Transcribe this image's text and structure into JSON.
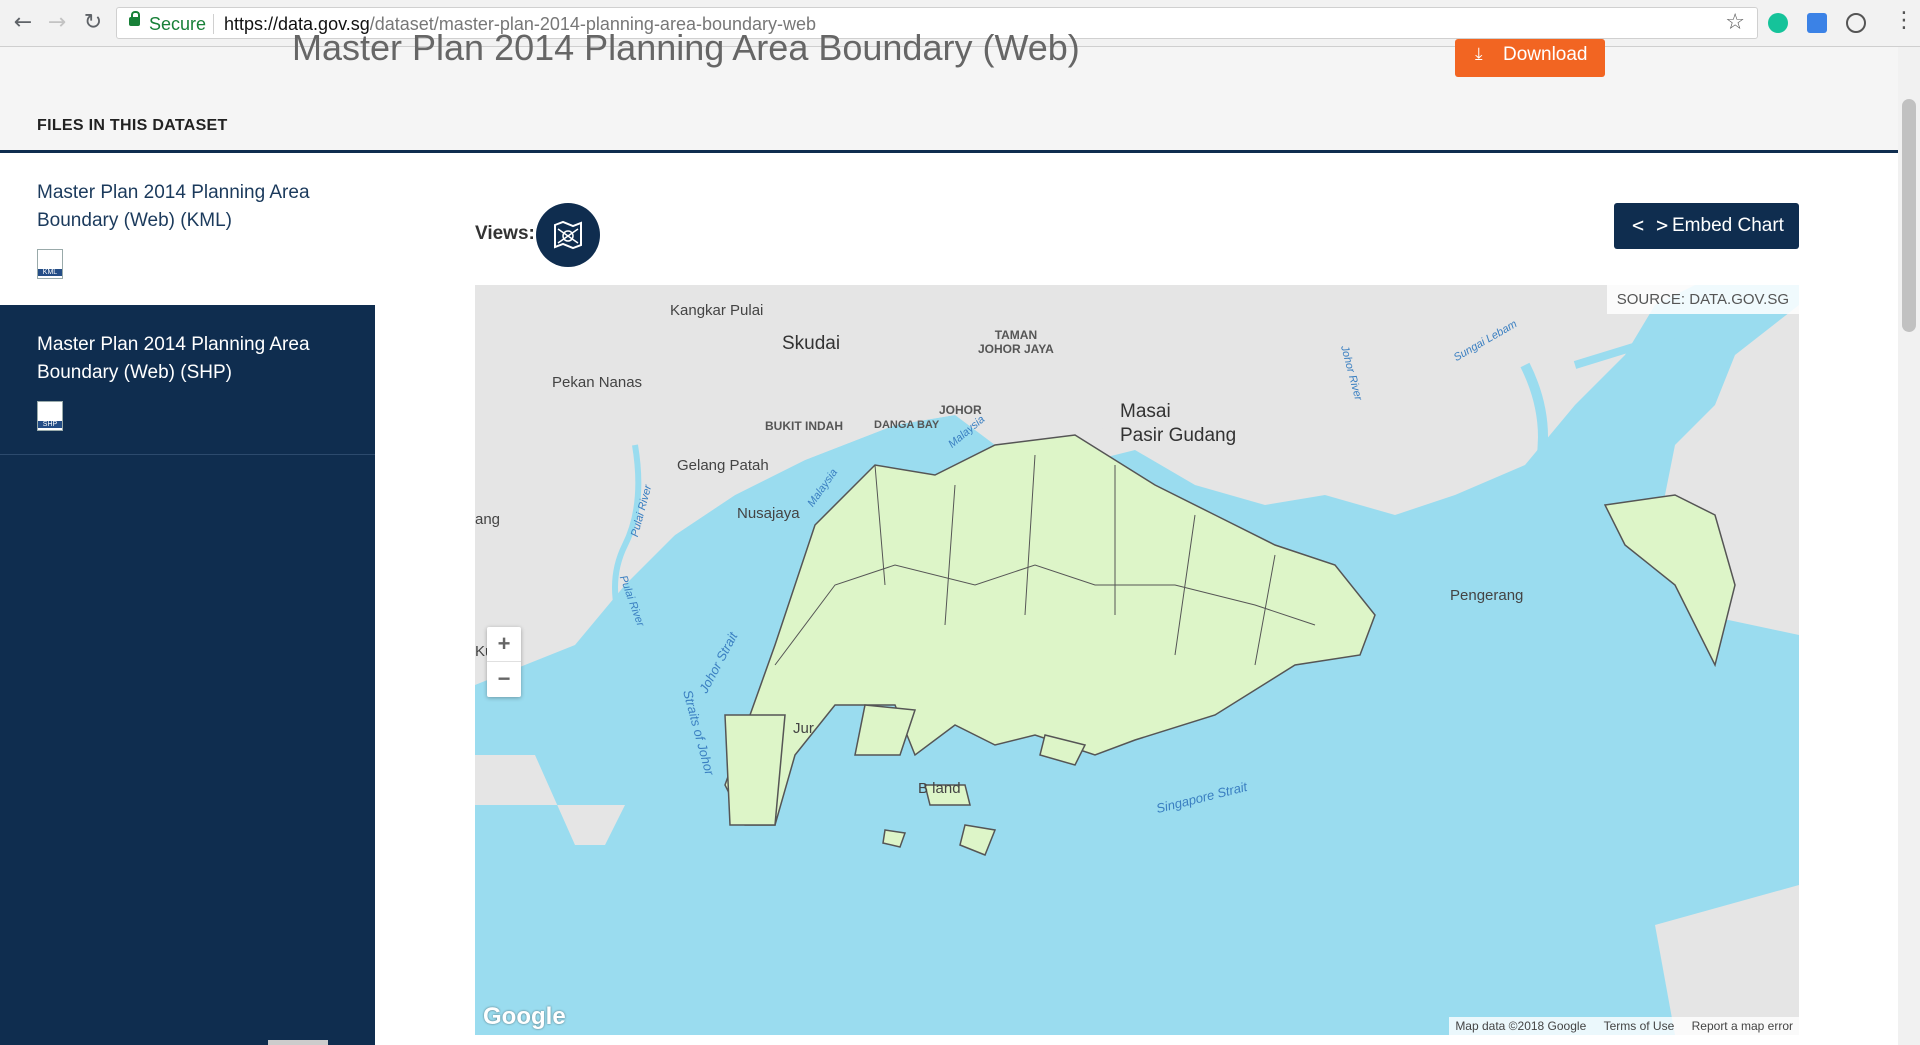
{
  "browser": {
    "secure_label": "Secure",
    "url_host": "https://data.gov.sg",
    "url_path": "/dataset/master-plan-2014-planning-area-boundary-web"
  },
  "page": {
    "title": "Master Plan 2014 Planning Area Boundary (Web)",
    "download_label": "Download",
    "files_heading": "FILES IN THIS DATASET"
  },
  "files": [
    {
      "title": "Master Plan 2014 Planning Area Boundary (Web) (KML)",
      "icon_label": "KML",
      "active": false
    },
    {
      "title": "Master Plan 2014 Planning Area Boundary (Web) (SHP)",
      "icon_label": "SHP",
      "active": true
    }
  ],
  "views_label": "Views:",
  "embed_label": "Embed Chart",
  "map": {
    "source": "SOURCE: DATA.GOV.SG",
    "zoom_in": "+",
    "zoom_out": "−",
    "logo": "Google",
    "attribution": [
      "Map data ©2018 Google",
      "Terms of Use",
      "Report a map error"
    ],
    "places": {
      "kangkar_pulai": "Kangkar Pulai",
      "skudai": "Skudai",
      "taman_johor_jaya": "TAMAN\nJOHOR JAYA",
      "pekan_nanas": "Pekan Nanas",
      "johor": "JOHOR",
      "bukit_indah": "BUKIT INDAH",
      "danga_bay": "DANGA BAY",
      "masai": "Masai",
      "pasir_gudang": "Pasir Gudang",
      "gelang_patah": "Gelang Patah",
      "nusajaya": "Nusajaya",
      "ang": "ang",
      "kukup": "Kukup",
      "pengerang": "Pengerang",
      "johor_strait": "Johor Strait",
      "straits_of_johor": "Straits of Johor",
      "singapore_strait": "Singapore Strait",
      "pulai_river": "Pulai River",
      "johor_river": "Johor River",
      "sungai_lebam": "Sungai Lebam",
      "malaysia": "Malaysia",
      "island_fragment": "B        land",
      "jur": "Jur"
    }
  },
  "colors": {
    "navy": "#0f2d4f",
    "orange": "#f26522",
    "water": "#9adcef",
    "land": "#e5e5e5",
    "singapore": "#ddf5c8"
  }
}
